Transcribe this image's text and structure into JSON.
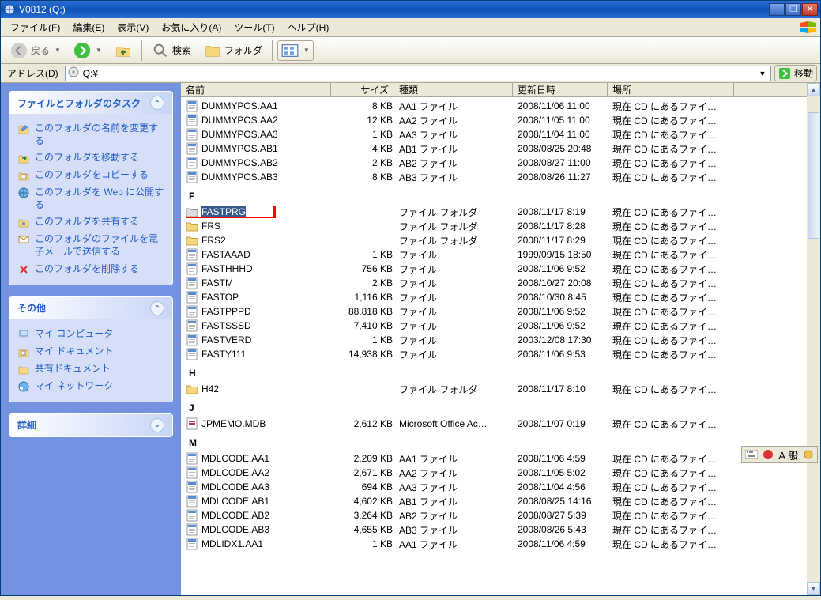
{
  "window": {
    "title": "V0812 (Q:)"
  },
  "menu": {
    "file": "ファイル(F)",
    "edit": "編集(E)",
    "view": "表示(V)",
    "favorites": "お気に入り(A)",
    "tools": "ツール(T)",
    "help": "ヘルプ(H)"
  },
  "toolbar": {
    "back": "戻る",
    "search": "検索",
    "folders": "フォルダ"
  },
  "address": {
    "label": "アドレス(D)",
    "value": "Q:¥",
    "go": "移動"
  },
  "sidepanel": {
    "tasks_hdr": "ファイルとフォルダのタスク",
    "task_rename": "このフォルダの名前を変更する",
    "task_move": "このフォルダを移動する",
    "task_copy": "このフォルダをコピーする",
    "task_publish": "このフォルダを Web に公開する",
    "task_share": "このフォルダを共有する",
    "task_email": "このフォルダのファイルを電子メールで送信する",
    "task_delete": "このフォルダを削除する",
    "other_hdr": "その他",
    "other_mycomputer": "マイ コンピュータ",
    "other_mydocs": "マイ ドキュメント",
    "other_shared": "共有ドキュメント",
    "other_network": "マイ ネットワーク",
    "detail_hdr": "詳細"
  },
  "columns": {
    "name": "名前",
    "size": "サイズ",
    "type": "種類",
    "date": "更新日時",
    "loc": "場所"
  },
  "loc_text": "現在 CD にあるファイ…",
  "groups": {
    "D": [
      {
        "name": "DUMMYPOS.AA1",
        "size": "8 KB",
        "type": "AA1 ファイル",
        "date": "2008/11/06 11:00"
      },
      {
        "name": "DUMMYPOS.AA2",
        "size": "12 KB",
        "type": "AA2 ファイル",
        "date": "2008/11/05 11:00"
      },
      {
        "name": "DUMMYPOS.AA3",
        "size": "1 KB",
        "type": "AA3 ファイル",
        "date": "2008/11/04 11:00"
      },
      {
        "name": "DUMMYPOS.AB1",
        "size": "4 KB",
        "type": "AB1 ファイル",
        "date": "2008/08/25 20:48"
      },
      {
        "name": "DUMMYPOS.AB2",
        "size": "2 KB",
        "type": "AB2 ファイル",
        "date": "2008/08/27 11:00"
      },
      {
        "name": "DUMMYPOS.AB3",
        "size": "8 KB",
        "type": "AB3 ファイル",
        "date": "2008/08/26 11:27"
      }
    ],
    "F": [
      {
        "name": "FASTPRG",
        "size": "",
        "type": "ファイル フォルダ",
        "date": "2008/11/17 8:19",
        "folder": true,
        "selected": true,
        "annot": true
      },
      {
        "name": "FRS",
        "size": "",
        "type": "ファイル フォルダ",
        "date": "2008/11/17 8:28",
        "folder": true
      },
      {
        "name": "FRS2",
        "size": "",
        "type": "ファイル フォルダ",
        "date": "2008/11/17 8:29",
        "folder": true
      },
      {
        "name": "FASTAAAD",
        "size": "1 KB",
        "type": "ファイル",
        "date": "1999/09/15 18:50"
      },
      {
        "name": "FASTHHHD",
        "size": "756 KB",
        "type": "ファイル",
        "date": "2008/11/06 9:52"
      },
      {
        "name": "FASTM",
        "size": "2 KB",
        "type": "ファイル",
        "date": "2008/10/27 20:08"
      },
      {
        "name": "FASTOP",
        "size": "1,116 KB",
        "type": "ファイル",
        "date": "2008/10/30 8:45"
      },
      {
        "name": "FASTPPPD",
        "size": "88,818 KB",
        "type": "ファイル",
        "date": "2008/11/06 9:52"
      },
      {
        "name": "FASTSSSD",
        "size": "7,410 KB",
        "type": "ファイル",
        "date": "2008/11/06 9:52"
      },
      {
        "name": "FASTVERD",
        "size": "1 KB",
        "type": "ファイル",
        "date": "2003/12/08 17:30"
      },
      {
        "name": "FASTY111",
        "size": "14,938 KB",
        "type": "ファイル",
        "date": "2008/11/06 9:53"
      }
    ],
    "H": [
      {
        "name": "H42",
        "size": "",
        "type": "ファイル フォルダ",
        "date": "2008/11/17 8:10",
        "folder": true
      }
    ],
    "J": [
      {
        "name": "JPMEMO.MDB",
        "size": "2,612 KB",
        "type": "Microsoft Office Ac…",
        "date": "2008/11/07 0:19",
        "mdb": true
      }
    ],
    "M": [
      {
        "name": "MDLCODE.AA1",
        "size": "2,209 KB",
        "type": "AA1 ファイル",
        "date": "2008/11/06 4:59"
      },
      {
        "name": "MDLCODE.AA2",
        "size": "2,671 KB",
        "type": "AA2 ファイル",
        "date": "2008/11/05 5:02"
      },
      {
        "name": "MDLCODE.AA3",
        "size": "694 KB",
        "type": "AA3 ファイル",
        "date": "2008/11/04 4:56"
      },
      {
        "name": "MDLCODE.AB1",
        "size": "4,602 KB",
        "type": "AB1 ファイル",
        "date": "2008/08/25 14:16"
      },
      {
        "name": "MDLCODE.AB2",
        "size": "3,264 KB",
        "type": "AB2 ファイル",
        "date": "2008/08/27 5:39"
      },
      {
        "name": "MDLCODE.AB3",
        "size": "4,655 KB",
        "type": "AB3 ファイル",
        "date": "2008/08/26 5:43"
      },
      {
        "name": "MDLIDX1.AA1",
        "size": "1 KB",
        "type": "AA1 ファイル",
        "date": "2008/11/06 4:59"
      }
    ]
  },
  "ime": {
    "mode": "A 般"
  }
}
